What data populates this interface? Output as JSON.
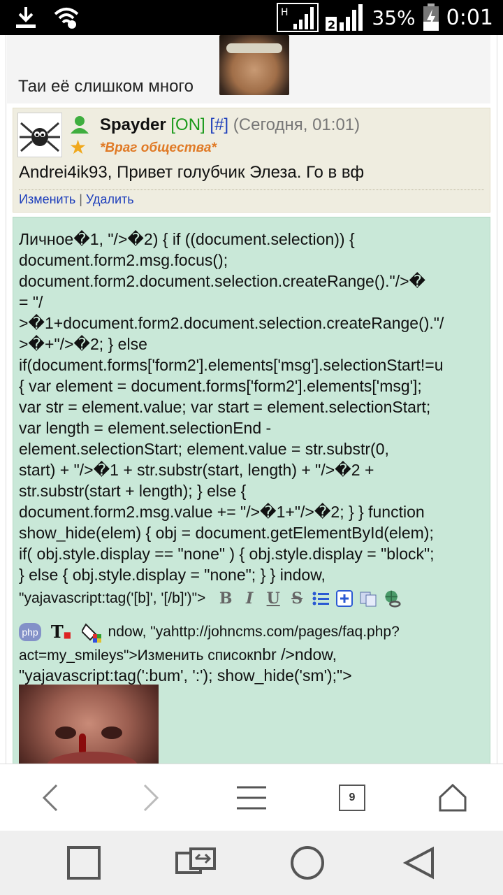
{
  "status_bar": {
    "battery_percent": "35%",
    "time": "0:01",
    "signal_label_1": "H",
    "signal_label_2": "2"
  },
  "previous_post": {
    "text": "Таи её слишком много"
  },
  "post": {
    "nick": "Spayder",
    "online": "[ON]",
    "hash": "[#]",
    "when": "(Сегодня, 01:01)",
    "status_title": "*Враг общества*",
    "text": "Andrei4ik93, Привет голубчик Элеза. Го в вф",
    "edit_label": "Изменить",
    "separator": "|",
    "delete_label": "Удалить"
  },
  "message": {
    "code": "Личное�1, \"/>�2) { if ((document.selection)) {\ndocument.form2.msg.focus();\ndocument.form2.document.selection.createRange().\"/>�\n= \"/\n>�1+document.form2.document.selection.createRange().\"/\n>�+\"/>�2; } else\nif(document.forms['form2'].elements['msg'].selectionStart!=u\n{ var element = document.forms['form2'].elements['msg'];\nvar str = element.value; var start = element.selectionStart;\nvar length = element.selectionEnd -\nelement.selectionStart; element.value = str.substr(0,\nstart) + \"/>�1 + str.substr(start, length) + \"/>�2 +\nstr.substr(start + length); } else {\ndocument.form2.msg.value += \"/>�1+\"/>�2; } } function\nshow_hide(elem) { obj = document.getElementById(elem);\nif( obj.style.display == \"none\" ) { obj.style.display = \"block\";\n} else { obj.style.display = \"none\"; } } indow,",
    "toolbar_prefix": "\"yajavascript:tag('[b]', '[/b]')\">",
    "toolbar_icons": [
      "B",
      "I",
      "U",
      "S"
    ],
    "line3_php": "php",
    "line3_text": "ndow, \"yahttp://johncms.com/pages/faq.php?",
    "line4_small": "act=my_smileys\">Изменить список",
    "line4_big": "nbr />ndow,",
    "line5": "\"yajavascript:tag(':bum', ':'); show_hide('sm');\">"
  },
  "browser_bar": {
    "tabs_count": "9"
  }
}
